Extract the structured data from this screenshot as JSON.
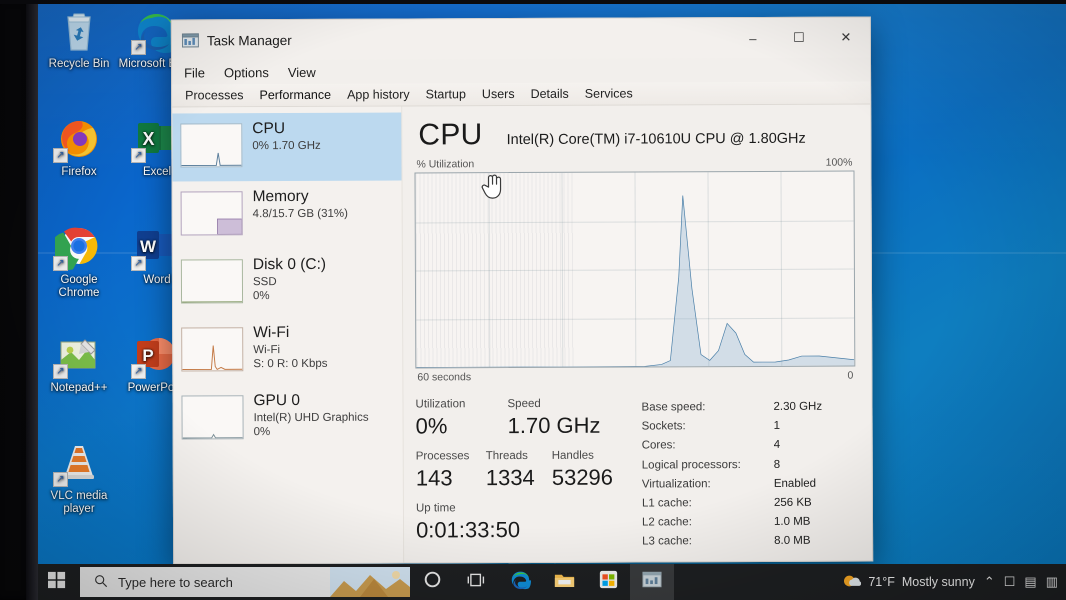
{
  "desktop": {
    "icons": [
      {
        "name": "recycle-bin",
        "label": "Recycle Bin",
        "icon": "recycle-bin-icon",
        "shortcut": false
      },
      {
        "name": "microsoft-edge",
        "label": "Microsoft Edge",
        "icon": "edge-icon",
        "shortcut": true
      },
      {
        "name": "firefox",
        "label": "Firefox",
        "icon": "firefox-icon",
        "shortcut": true
      },
      {
        "name": "excel",
        "label": "Excel",
        "icon": "excel-icon",
        "shortcut": true
      },
      {
        "name": "google-chrome",
        "label": "Google Chrome",
        "icon": "chrome-icon",
        "shortcut": true
      },
      {
        "name": "word",
        "label": "Word",
        "icon": "word-icon",
        "shortcut": true
      },
      {
        "name": "notepad-plus",
        "label": "Notepad++",
        "icon": "notepadpp-icon",
        "shortcut": true
      },
      {
        "name": "powerpoint",
        "label": "PowerPoint",
        "icon": "powerpoint-icon",
        "shortcut": true
      },
      {
        "name": "vlc",
        "label": "VLC media player",
        "icon": "vlc-cone-icon",
        "shortcut": true
      }
    ]
  },
  "window": {
    "title": "Task Manager",
    "icon": "task-manager-icon",
    "controls": {
      "minimize": "–",
      "maximize": "☐",
      "close": "✕"
    },
    "menu": [
      "File",
      "Options",
      "View"
    ],
    "tabs": [
      {
        "label": "Processes",
        "active": false
      },
      {
        "label": "Performance",
        "active": true
      },
      {
        "label": "App history",
        "active": false
      },
      {
        "label": "Startup",
        "active": false
      },
      {
        "label": "Users",
        "active": false
      },
      {
        "label": "Details",
        "active": false
      },
      {
        "label": "Services",
        "active": false
      }
    ]
  },
  "sidebar": {
    "items": [
      {
        "title": "CPU",
        "line1": "0%  1.70 GHz",
        "line2": "",
        "selected": true
      },
      {
        "title": "Memory",
        "line1": "4.8/15.7 GB (31%)",
        "line2": "",
        "selected": false
      },
      {
        "title": "Disk 0 (C:)",
        "line1": "SSD",
        "line2": "0%",
        "selected": false
      },
      {
        "title": "Wi-Fi",
        "line1": "Wi-Fi",
        "line2": "S: 0 R: 0 Kbps",
        "selected": false
      },
      {
        "title": "GPU 0",
        "line1": "Intel(R) UHD Graphics",
        "line2": "0%",
        "selected": false
      }
    ]
  },
  "main": {
    "heading": "CPU",
    "model": "Intel(R) Core(TM) i7-10610U CPU @ 1.80GHz",
    "graph": {
      "y_label": "% Utilization",
      "y_max_label": "100%",
      "x_left_label": "60 seconds",
      "x_right_label": "0"
    },
    "stats": [
      {
        "key": "Utilization",
        "value": "0%"
      },
      {
        "key": "Speed",
        "value": "1.70 GHz"
      },
      {
        "key": "Processes",
        "value": "143"
      },
      {
        "key": "Threads",
        "value": "1334"
      },
      {
        "key": "Handles",
        "value": "53296"
      },
      {
        "key": "Up time",
        "value": "0:01:33:50"
      }
    ],
    "specs": [
      {
        "key": "Base speed:",
        "value": "2.30 GHz"
      },
      {
        "key": "Sockets:",
        "value": "1"
      },
      {
        "key": "Cores:",
        "value": "4"
      },
      {
        "key": "Logical processors:",
        "value": "8"
      },
      {
        "key": "Virtualization:",
        "value": "Enabled"
      },
      {
        "key": "L1 cache:",
        "value": "256 KB"
      },
      {
        "key": "L2 cache:",
        "value": "1.0 MB"
      },
      {
        "key": "L3 cache:",
        "value": "8.0 MB"
      }
    ]
  },
  "chart_data": {
    "type": "area",
    "title": "% Utilization",
    "xlabel": "60 seconds",
    "ylabel": "% Utilization",
    "ylim": [
      0,
      100
    ],
    "xlim": [
      60,
      0
    ],
    "grid": true,
    "legend": "none",
    "x": [
      60,
      58,
      56,
      54,
      52,
      50,
      48,
      46,
      44,
      42,
      40,
      38,
      36,
      34,
      32,
      30,
      28,
      26,
      24,
      22,
      20,
      19,
      18,
      17,
      16,
      15,
      14,
      13,
      12,
      11,
      10,
      9,
      8,
      7,
      6,
      5,
      4,
      3,
      2,
      1,
      0
    ],
    "series": [
      {
        "name": "CPU utilization",
        "values": [
          0,
          0,
          0,
          0,
          0,
          0,
          0,
          0,
          0,
          0,
          0,
          0,
          0,
          0,
          0,
          0,
          0,
          0,
          0,
          0,
          0,
          1,
          3,
          46,
          88,
          40,
          6,
          3,
          8,
          22,
          17,
          6,
          2,
          2,
          2,
          2,
          3,
          5,
          6,
          4,
          3
        ]
      }
    ]
  },
  "taskbar": {
    "start": "windows-logo-icon",
    "search_placeholder": "Type here to search",
    "search_icon": "search-icon",
    "items": [
      {
        "name": "cortana",
        "icon": "cortana-circle-icon",
        "active": false
      },
      {
        "name": "task-view",
        "icon": "task-view-icon",
        "active": false
      },
      {
        "name": "edge",
        "icon": "edge-icon",
        "active": false
      },
      {
        "name": "file-explorer",
        "icon": "folder-icon",
        "active": false
      },
      {
        "name": "microsoft-store",
        "icon": "store-icon",
        "active": false
      },
      {
        "name": "task-manager",
        "icon": "task-manager-icon",
        "active": true
      }
    ],
    "weather": {
      "icon": "sun-cloud-icon",
      "temperature": "71°F",
      "condition": "Mostly sunny"
    },
    "tray": [
      "⌃",
      "☐",
      "▤",
      "▥"
    ]
  },
  "colors": {
    "accent": "#0a66cc",
    "selection": "#bcd9ef",
    "window_bg": "#f2efec",
    "taskbar": "#1d1f21",
    "graph_line": "#4a7fa8"
  }
}
